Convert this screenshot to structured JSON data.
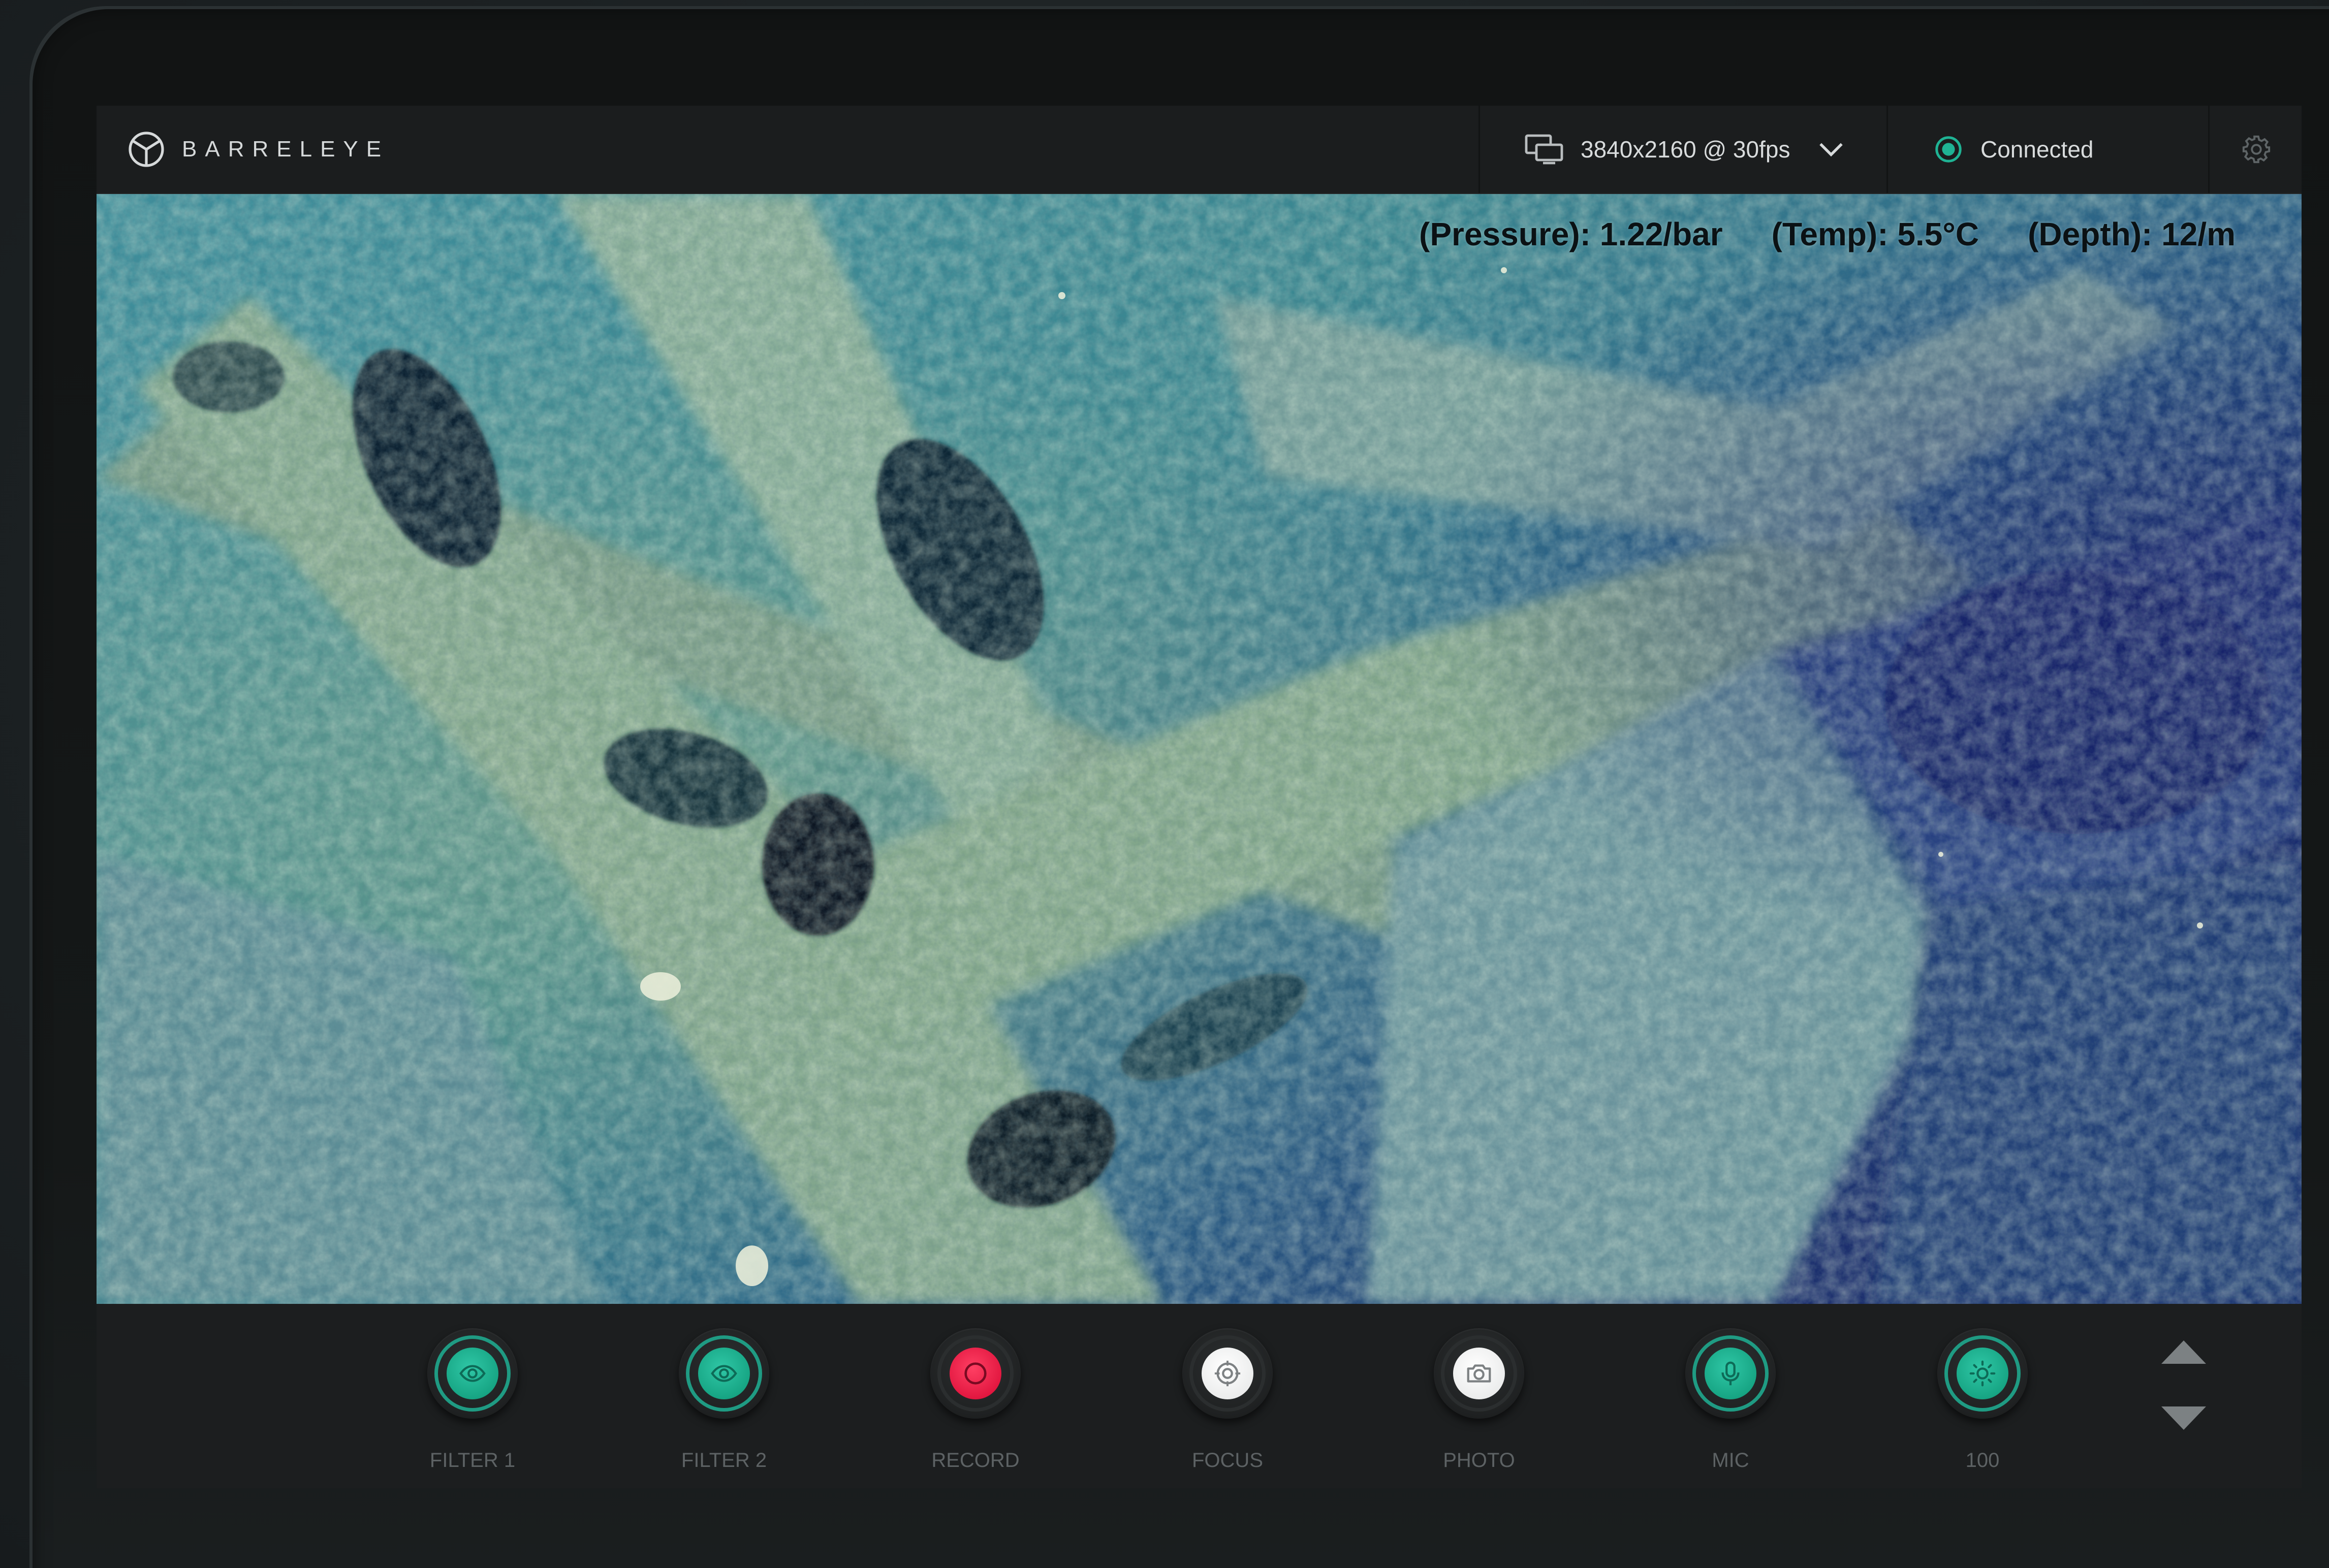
{
  "app": {
    "brand_name": "BARRELEYE",
    "logo_icon": "barreleye-logo-icon"
  },
  "header": {
    "resolution": {
      "icon": "display-icon",
      "label": "3840x2160 @ 30fps",
      "dropdown_icon": "chevron-down-icon"
    },
    "connection": {
      "icon": "status-dot-icon",
      "label": "Connected",
      "color": "#1fb394"
    },
    "settings_icon": "gear-icon"
  },
  "telemetry": {
    "pressure": "(Pressure): 1.22/bar",
    "temp": "(Temp): 5.5°C",
    "depth": "(Depth): 12/m"
  },
  "controls": [
    {
      "label": "FILTER 1",
      "icon": "eye-icon",
      "style": "teal"
    },
    {
      "label": "FILTER 2",
      "icon": "eye-icon",
      "style": "teal"
    },
    {
      "label": "RECORD",
      "icon": "record-icon",
      "style": "red"
    },
    {
      "label": "FOCUS",
      "icon": "focus-icon",
      "style": "white"
    },
    {
      "label": "PHOTO",
      "icon": "camera-icon",
      "style": "white"
    },
    {
      "label": "MIC",
      "icon": "microphone-icon",
      "style": "teal"
    },
    {
      "label": "100",
      "icon": "brightness-icon",
      "style": "teal"
    }
  ],
  "colors": {
    "accent_teal": "#17a584",
    "record_red": "#e0153e",
    "bar_background": "#1c1e1f"
  }
}
